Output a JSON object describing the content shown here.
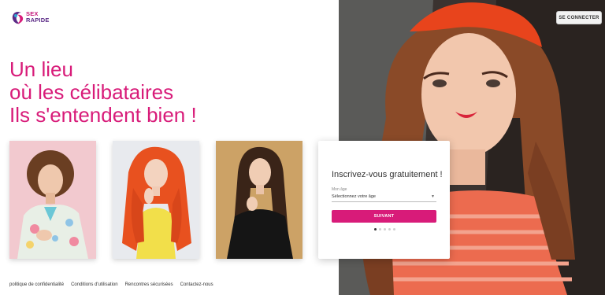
{
  "brand": {
    "line1": "SEX",
    "line2": "RAPIDE",
    "accent": "#d81b79",
    "secondary": "#5b2a86"
  },
  "header": {
    "login_label": "SE CONNECTER"
  },
  "hero": {
    "headline": [
      "Un lieu",
      "où les célibataires",
      "Ils s'entendent bien !"
    ]
  },
  "signup": {
    "title": "Inscrivez-vous gratuitement !",
    "age_label": "Mon âge",
    "age_selected": "Sélectionnez votre âge",
    "next_label": "SUIVANT",
    "steps_total": 5,
    "steps_current": 1
  },
  "footer": {
    "links": [
      "politique de confidentialité",
      "Conditions d'utilisation",
      "Rencontres sécurisées",
      "Contactez-nous"
    ]
  },
  "icons": {
    "select_chevron": "chevron-down-icon",
    "logo": "logo-icon"
  }
}
